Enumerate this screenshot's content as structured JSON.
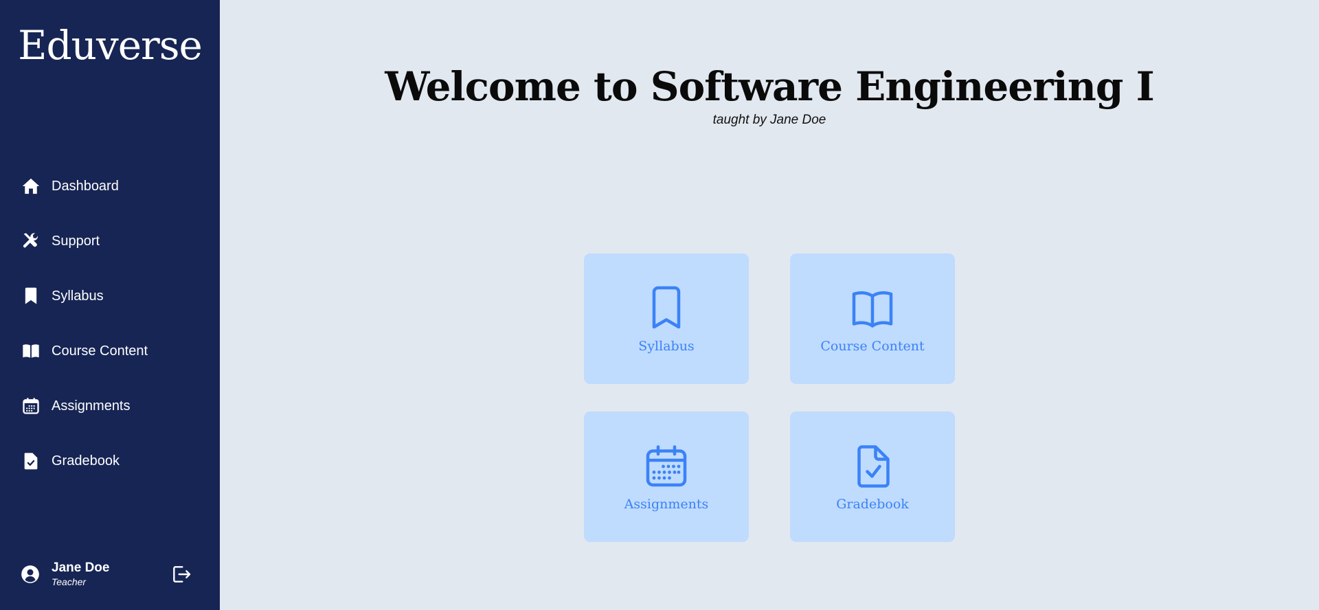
{
  "brand": "Eduverse",
  "sidebar": {
    "items": [
      {
        "label": "Dashboard",
        "icon": "home-icon"
      },
      {
        "label": "Support",
        "icon": "tools-icon"
      },
      {
        "label": "Syllabus",
        "icon": "bookmark-icon"
      },
      {
        "label": "Course Content",
        "icon": "book-open-icon"
      },
      {
        "label": "Assignments",
        "icon": "calendar-icon"
      },
      {
        "label": "Gradebook",
        "icon": "file-check-icon"
      }
    ]
  },
  "user": {
    "name": "Jane Doe",
    "role": "Teacher",
    "avatar_icon": "user-circle-icon",
    "logout_icon": "logout-icon"
  },
  "main": {
    "title": "Welcome to Software Engineering I",
    "subtitle": "taught by Jane Doe",
    "cards": [
      {
        "label": "Syllabus",
        "icon": "bookmark-icon"
      },
      {
        "label": "Course Content",
        "icon": "book-open-icon"
      },
      {
        "label": "Assignments",
        "icon": "calendar-icon"
      },
      {
        "label": "Gradebook",
        "icon": "file-check-icon"
      }
    ]
  },
  "colors": {
    "sidebar_bg": "#172554",
    "page_bg": "#e2e8f0",
    "card_bg": "#bfdbfe",
    "accent": "#3b82f6"
  }
}
